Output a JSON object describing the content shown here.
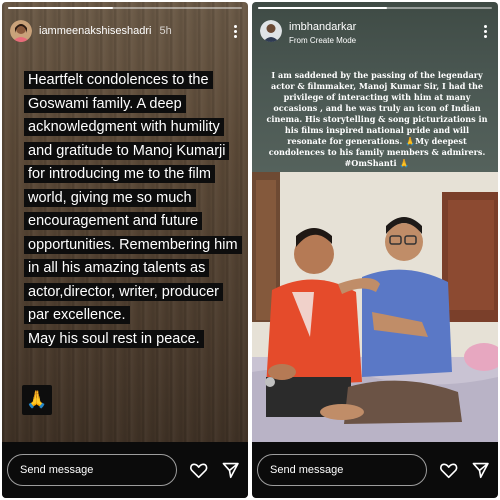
{
  "left_story": {
    "username": "iammeenakshiseshadri",
    "time": "5h",
    "text_lines": [
      "Heartfelt condolences to the",
      "Goswami family. A deep",
      "acknowledgment with humility",
      "and gratitude to Manoj Kumarji",
      "for introducing me to the film",
      "world, giving me so much",
      "encouragement and future",
      "opportunities. Remembering him",
      "in all his amazing talents as",
      "actor,director, writer, producer",
      "par excellence.",
      "May his soul rest in peace."
    ],
    "emoji": "🙏",
    "progress": 0.45,
    "send_placeholder": "Send message"
  },
  "right_story": {
    "username": "imbhandarkar",
    "subtitle": "From Create Mode",
    "caption": "I am saddened by the passing of the legendary actor & filmmaker, Manoj Kumar Sir, I had the privilege of interacting with him at many occasions , and he was truly an icon of Indian cinema. His storytelling & song picturizations in his films inspired national pride and will resonate for generations. 🙏My deepest condolences to his family members & admirers. #OmShanti 🙏",
    "progress": 0.55,
    "send_placeholder": "Send message"
  },
  "icons": {
    "heart": "heart-icon",
    "send": "send-icon",
    "menu": "more-vertical-icon"
  },
  "colors": {
    "panel_dark": "#0b0b0b",
    "text_highlight": "#0d0d0d",
    "caption_bg": "#4a5752"
  }
}
